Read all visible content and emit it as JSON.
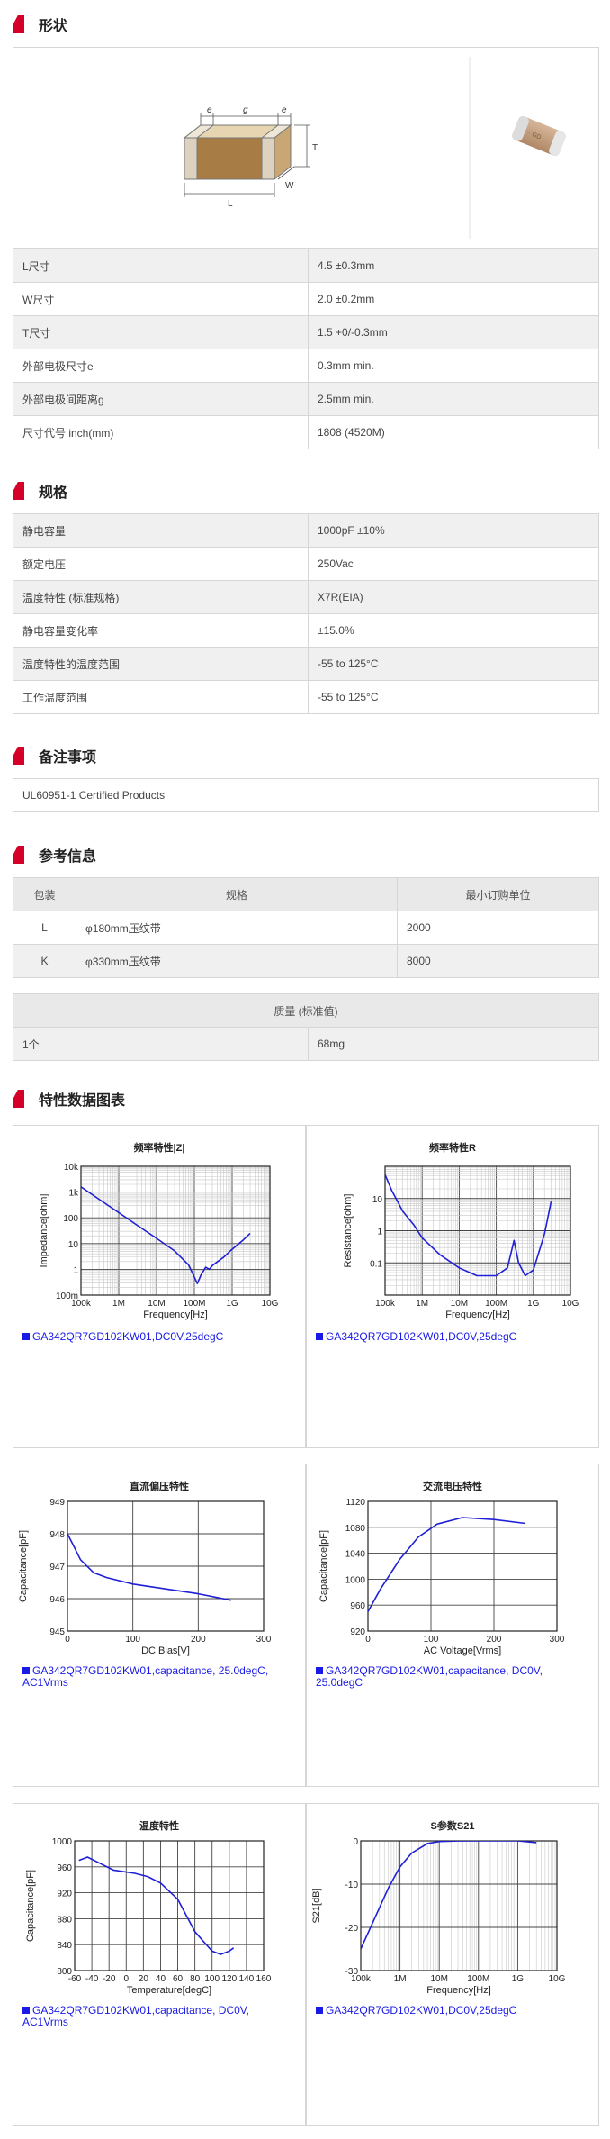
{
  "sections": {
    "shape": "形状",
    "spec": "规格",
    "notes": "备注事项",
    "ref": "参考信息",
    "charts": "特性数据图表"
  },
  "dims": {
    "labels": {
      "e": "e",
      "g": "g",
      "T": "T",
      "W": "W",
      "L": "L"
    },
    "rows": [
      {
        "name": "L尺寸",
        "value": "4.5 ±0.3mm"
      },
      {
        "name": "W尺寸",
        "value": "2.0 ±0.2mm"
      },
      {
        "name": "T尺寸",
        "value": "1.5 +0/-0.3mm"
      },
      {
        "name": "外部电极尺寸e",
        "value": "0.3mm min."
      },
      {
        "name": "外部电极间距离g",
        "value": "2.5mm min."
      },
      {
        "name": "尺寸代号 inch(mm)",
        "value": "1808 (4520M)"
      }
    ]
  },
  "spec": {
    "rows": [
      {
        "name": "静电容量",
        "value": "1000pF ±10%"
      },
      {
        "name": "额定电压",
        "value": "250Vac"
      },
      {
        "name": "温度特性 (标准规格)",
        "value": "X7R(EIA)"
      },
      {
        "name": "静电容量变化率",
        "value": "±15.0%"
      },
      {
        "name": "温度特性的温度范围",
        "value": "-55 to 125°C"
      },
      {
        "name": "工作温度范围",
        "value": "-55 to 125°C"
      }
    ]
  },
  "notes": {
    "text": "UL60951-1 Certified Products"
  },
  "ref": {
    "headers": [
      "包装",
      "规格",
      "最小订购单位"
    ],
    "rows": [
      {
        "code": "L",
        "spec": "φ180mm压纹带",
        "moq": "2000"
      },
      {
        "code": "K",
        "spec": "φ330mm压纹带",
        "moq": "8000"
      }
    ],
    "mass_header": "质量 (标准值)",
    "mass_row": {
      "unit": "1个",
      "value": "68mg"
    }
  },
  "chart_data": [
    {
      "type": "line",
      "title": "频率特性|Z|",
      "xlabel": "Frequency[Hz]",
      "ylabel": "Impedance[ohm]",
      "xscale": "log",
      "yscale": "log",
      "xlim": [
        100000,
        10000000000
      ],
      "ylim": [
        0.1,
        10000
      ],
      "xticks": [
        "100k",
        "1M",
        "10M",
        "100M",
        "1G",
        "10G"
      ],
      "yticks": [
        "100m",
        "1",
        "10",
        "100",
        "1k",
        "10k"
      ],
      "series": [
        {
          "name": "GA342QR7GD102KW01,DC0V,25degC",
          "x": [
            100000,
            300000,
            1000000,
            3000000,
            10000000,
            30000000,
            70000000,
            100000000,
            120000000,
            150000000,
            200000000,
            250000000,
            300000000,
            600000000,
            1000000000,
            2000000000,
            3000000000
          ],
          "y": [
            1600,
            530,
            160,
            53,
            16,
            5.2,
            1.5,
            0.5,
            0.28,
            0.6,
            1.2,
            1.0,
            1.4,
            3,
            6,
            14,
            25
          ]
        }
      ],
      "legend": "bottom-left"
    },
    {
      "type": "line",
      "title": "频率特性R",
      "xlabel": "Frequency[Hz]",
      "ylabel": "Resistance[ohm]",
      "xscale": "log",
      "yscale": "log",
      "xlim": [
        100000,
        10000000000
      ],
      "ylim": [
        0.01,
        100
      ],
      "xticks": [
        "100k",
        "1M",
        "10M",
        "100M",
        "1G",
        "10G"
      ],
      "yticks": [
        "0.1",
        "1",
        "10"
      ],
      "series": [
        {
          "name": "GA342QR7GD102KW01,DC0V,25degC",
          "x": [
            100000,
            150000,
            300000,
            600000,
            1000000,
            3000000,
            10000000,
            30000000,
            100000000,
            200000000,
            300000000,
            400000000,
            600000000,
            1000000000,
            2000000000,
            3000000000
          ],
          "y": [
            55,
            18,
            4,
            1.5,
            0.6,
            0.18,
            0.07,
            0.04,
            0.04,
            0.07,
            0.5,
            0.1,
            0.04,
            0.06,
            0.8,
            8
          ]
        }
      ],
      "legend": "bottom-left"
    },
    {
      "type": "line",
      "title": "直流偏压特性",
      "xlabel": "DC Bias[V]",
      "ylabel": "Capacitance[pF]",
      "xlim": [
        0,
        300
      ],
      "ylim": [
        945,
        949
      ],
      "xticks": [
        "0",
        "100",
        "200",
        "300"
      ],
      "yticks": [
        "945",
        "946",
        "947",
        "948",
        "949"
      ],
      "series": [
        {
          "name": "GA342QR7GD102KW01,capacitance, 25.0degC, AC1Vrms",
          "x": [
            0,
            10,
            20,
            40,
            60,
            100,
            150,
            200,
            250
          ],
          "y": [
            948.0,
            947.6,
            947.2,
            946.8,
            946.65,
            946.45,
            946.3,
            946.15,
            945.95
          ]
        }
      ],
      "legend": "bottom-left"
    },
    {
      "type": "line",
      "title": "交流电压特性",
      "xlabel": "AC Voltage[Vrms]",
      "ylabel": "Capacitance[pF]",
      "xlim": [
        0,
        300
      ],
      "ylim": [
        920,
        1120
      ],
      "xticks": [
        "0",
        "100",
        "200",
        "300"
      ],
      "yticks": [
        "920",
        "960",
        "1000",
        "1040",
        "1080",
        "1120"
      ],
      "series": [
        {
          "name": "GA342QR7GD102KW01,capacitance, DC0V, 25.0degC",
          "x": [
            0,
            20,
            50,
            80,
            110,
            150,
            200,
            250
          ],
          "y": [
            950,
            985,
            1030,
            1065,
            1085,
            1095,
            1092,
            1086
          ]
        }
      ],
      "legend": "bottom-left"
    },
    {
      "type": "line",
      "title": "温度特性",
      "xlabel": "Temperature[degC]",
      "ylabel": "Capacitance[pF]",
      "xlim": [
        -60,
        160
      ],
      "ylim": [
        800,
        1000
      ],
      "xticks": [
        "-60",
        "-40",
        "-20",
        "0",
        "20",
        "40",
        "60",
        "80",
        "100",
        "120",
        "140",
        "160"
      ],
      "yticks": [
        "800",
        "840",
        "880",
        "920",
        "960",
        "1000"
      ],
      "series": [
        {
          "name": "GA342QR7GD102KW01,capacitance, DC0V, AC1Vrms",
          "x": [
            -55,
            -45,
            -30,
            -15,
            0,
            10,
            25,
            40,
            60,
            80,
            100,
            110,
            120,
            125
          ],
          "y": [
            970,
            975,
            965,
            955,
            952,
            950,
            945,
            935,
            910,
            860,
            830,
            825,
            830,
            835
          ]
        }
      ],
      "legend": "bottom-left"
    },
    {
      "type": "line",
      "title": "S参数S21",
      "xlabel": "Frequency[Hz]",
      "ylabel": "S21[dB]",
      "xscale": "log",
      "xlim": [
        100000,
        10000000000
      ],
      "ylim": [
        -30,
        0
      ],
      "xticks": [
        "100k",
        "1M",
        "10M",
        "100M",
        "1G",
        "10G"
      ],
      "yticks": [
        "-30",
        "-20",
        "-10",
        "0"
      ],
      "series": [
        {
          "name": "GA342QR7GD102KW01,DC0V,25degC",
          "x": [
            100000,
            200000,
            500000,
            1000000,
            2000000,
            5000000,
            10000000,
            30000000,
            100000000,
            300000000,
            1000000000,
            3000000000
          ],
          "y": [
            -25,
            -19,
            -11,
            -6,
            -2.8,
            -0.6,
            -0.15,
            -0.03,
            0,
            0,
            0,
            -0.4
          ]
        }
      ],
      "legend": "bottom-left"
    }
  ]
}
